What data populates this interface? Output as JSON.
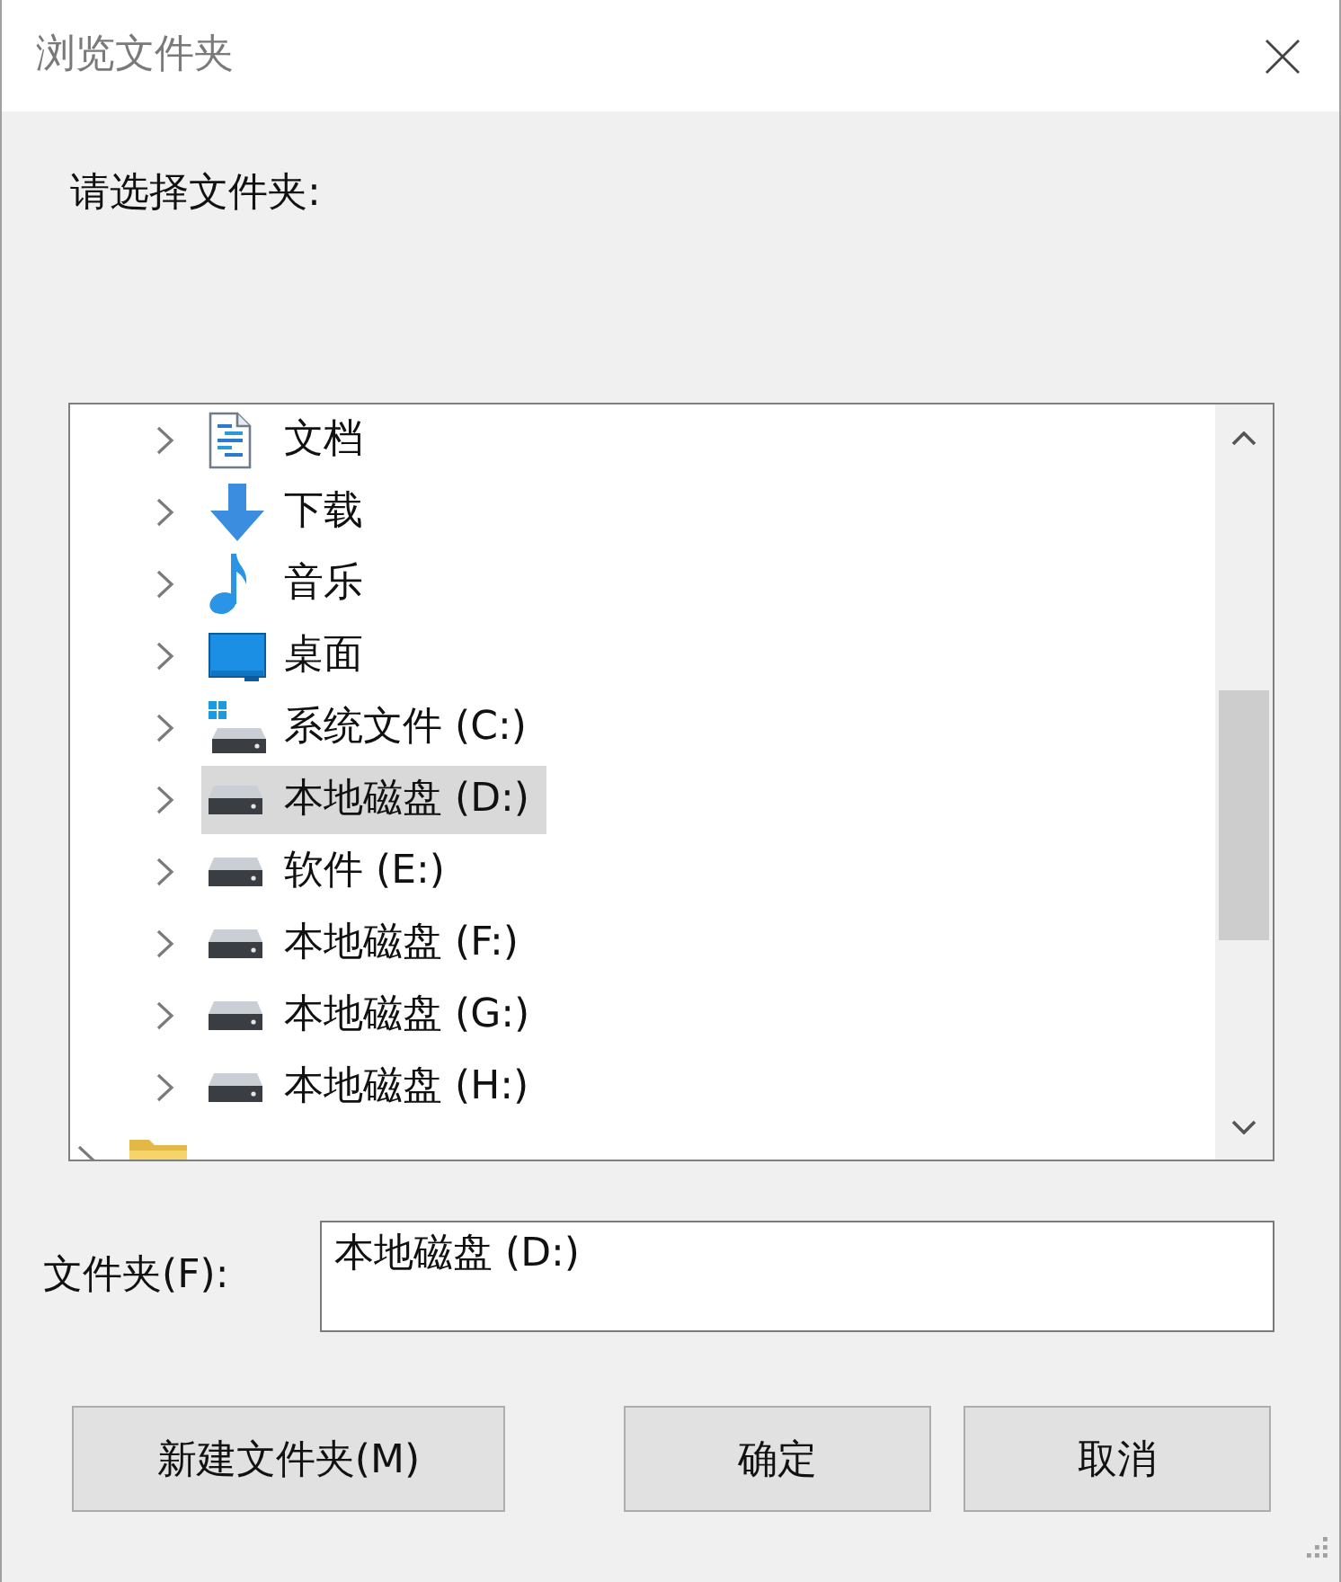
{
  "window": {
    "title": "浏览文件夹"
  },
  "prompt": "请选择文件夹:",
  "tree": {
    "items": [
      {
        "children": [
          {
            "label": "文档",
            "kind": "documents",
            "expanded": false,
            "selected": false
          },
          {
            "label": "下载",
            "kind": "downloads",
            "expanded": false,
            "selected": false
          },
          {
            "label": "音乐",
            "kind": "music",
            "expanded": false,
            "selected": false
          },
          {
            "label": "桌面",
            "kind": "desktop",
            "expanded": false,
            "selected": false
          },
          {
            "label": "系统文件 (C:)",
            "kind": "system-drive",
            "expanded": false,
            "selected": false
          },
          {
            "label": "本地磁盘 (D:)",
            "kind": "drive",
            "expanded": false,
            "selected": true
          },
          {
            "label": "软件 (E:)",
            "kind": "drive",
            "expanded": false,
            "selected": false
          },
          {
            "label": "本地磁盘 (F:)",
            "kind": "drive",
            "expanded": false,
            "selected": false
          },
          {
            "label": "本地磁盘 (G:)",
            "kind": "drive",
            "expanded": false,
            "selected": false
          },
          {
            "label": "本地磁盘 (H:)",
            "kind": "drive",
            "expanded": false,
            "selected": false
          }
        ]
      },
      {
        "kind": "folder",
        "expanded": false,
        "selected": false
      }
    ]
  },
  "folder_field": {
    "label": "文件夹(F):",
    "value": "本地磁盘 (D:)"
  },
  "buttons": [
    {
      "label": "新建文件夹(M)"
    },
    {
      "label": "确定"
    },
    {
      "label": "取消"
    }
  ]
}
